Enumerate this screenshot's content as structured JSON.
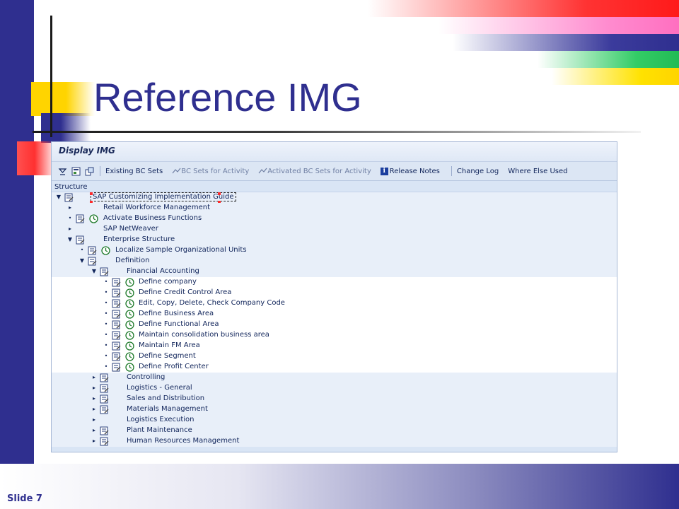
{
  "slide": {
    "title": "Reference IMG",
    "slide_number": "Slide 7",
    "colors": {
      "title": "#2f2f8f",
      "accent_blue": "#2f2f8f",
      "accent_red": "#ff3333",
      "accent_yellow": "#ffd400",
      "accent_green": "#33cc66",
      "accent_pink": "#ff8ccf"
    }
  },
  "sap": {
    "window_title": "Display IMG",
    "toolbar": {
      "icons": [
        "expand-subtree-icon",
        "display-icon",
        "navigation-icon"
      ],
      "existing_bc_sets": "Existing BC Sets",
      "bc_sets_for_activity": "BC Sets for Activity",
      "activated_bc_sets_for_activity": "Activated BC Sets for Activity",
      "release_notes": "Release Notes",
      "change_log": "Change Log",
      "where_else_used": "Where Else Used"
    },
    "structure_header": "Structure",
    "tree": {
      "root": "SAP Customizing Implementation Guide",
      "n1": "Retail Workforce Management",
      "n2": "Activate Business Functions",
      "n3": "SAP NetWeaver",
      "n4": "Enterprise Structure",
      "n5": "Localize Sample Organizational Units",
      "n6": "Definition",
      "n7": "Financial Accounting",
      "n8": "Define company",
      "n9": "Define Credit Control Area",
      "n10": "Edit, Copy, Delete, Check Company Code",
      "n11": "Define Business Area",
      "n12": "Define Functional Area",
      "n13": "Maintain consolidation business area",
      "n14": "Maintain FM Area",
      "n15": "Define Segment",
      "n16": "Define Profit Center",
      "n17": "Controlling",
      "n18": "Logistics - General",
      "n19": "Sales and Distribution",
      "n20": "Materials Management",
      "n21": "Logistics Execution",
      "n22": "Plant Maintenance",
      "n23": "Human Resources Management"
    }
  }
}
